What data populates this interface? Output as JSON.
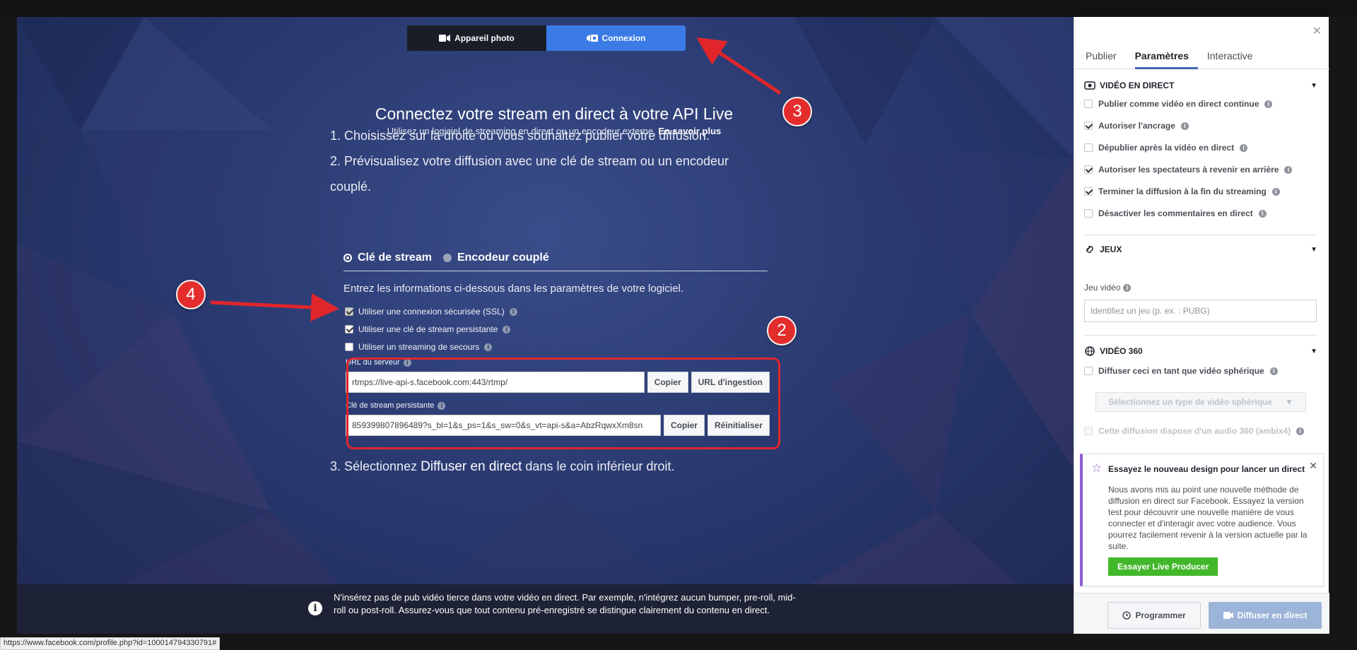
{
  "tabs": {
    "camera": "Appareil photo",
    "connection": "Connexion"
  },
  "header": {
    "title": "Connectez votre stream en direct à votre API Live",
    "subtitle": "Utilisez un logiciel de streaming en direct ou un encodeur externe.",
    "learn_more": "En savoir plus"
  },
  "steps": {
    "s1": "1. Choisissez sur la droite où vous souhaitez publier votre diffusion.",
    "s2a": "2. Prévisualisez votre diffusion avec une clé de stream ou un encodeur",
    "s2b": "couplé.",
    "s3_pre": "3. Sélectionnez",
    "s3_bold": "Diffuser en direct",
    "s3_post": "dans le coin inférieur droit."
  },
  "stream_mode": {
    "option1": "Clé de stream",
    "option2": "Encodeur couplé"
  },
  "instructions": "Entrez les informations ci-dessous dans les paramètres de votre logiciel.",
  "options": {
    "ssl": "Utiliser une connexion sécurisée (SSL)",
    "persistent_key": "Utiliser une clé de stream persistante",
    "backup": "Utiliser un streaming de secours"
  },
  "server": {
    "label": "URL du serveur",
    "value": "rtmps://live-api-s.facebook.com:443/rtmp/",
    "copy": "Copier",
    "ingest": "URL d'ingestion"
  },
  "key": {
    "label": "Clé de stream persistante",
    "value": "859399807896489?s_bl=1&s_ps=1&s_sw=0&s_vt=api-s&a=AbzRqwxXm8sn",
    "copy": "Copier",
    "reset": "Réinitialiser"
  },
  "notice": "N'insérez pas de pub vidéo tierce dans votre vidéo en direct. Par exemple, n'intégrez aucun bumper, pre-roll, mid-roll ou post-roll. Assurez-vous que tout contenu pré-enregistré se distingue clairement du contenu en direct.",
  "status_url": "https://www.facebook.com/profile.php?id=100014794330791#",
  "annotations": [
    "2",
    "3",
    "4"
  ],
  "panel": {
    "tabs": [
      "Publier",
      "Paramètres",
      "Interactive"
    ],
    "live_section": "VIDÉO EN DIRECT",
    "live_options": [
      "Publier comme vidéo en direct continue",
      "Autoriser l'ancrage",
      "Dépublier après la vidéo en direct",
      "Autoriser les spectateurs à revenir en arrière",
      "Terminer la diffusion à la fin du streaming",
      "Désactiver les commentaires en direct"
    ],
    "games_section": "JEUX",
    "game_label": "Jeu vidéo",
    "game_placeholder": "Identifiez un jeu (p. ex. : PUBG)",
    "v360_section": "VIDÉO 360",
    "v360_option": "Diffuser ceci en tant que vidéo sphérique",
    "v360_select": "Sélectionnez un type de vidéo sphérique",
    "v360_audio": "Cette diffusion dispose d'un audio 360 (ambix4)",
    "promo_title": "Essayez le nouveau design pour lancer un direct",
    "promo_body": "Nous avons mis au point une nouvelle méthode de diffusion en direct sur Facebook. Essayez la version test pour découvrir une nouvelle manière de vous connecter et d'interagir avec votre audience. Vous pourrez facilement revenir à la version actuelle par la suite.",
    "promo_button": "Essayer Live Producer",
    "schedule": "Programmer",
    "go_live": "Diffuser en direct"
  },
  "colors": {
    "accent": "#3b7be6",
    "annotation": "#e32d2d",
    "promo_button": "#42b72a"
  }
}
